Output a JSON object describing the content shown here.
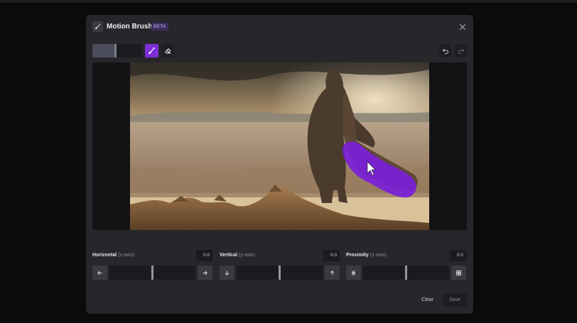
{
  "header": {
    "title": "Motion Brush",
    "badge": "BETA",
    "brand_icon": "brush-icon",
    "close_icon": "close-icon"
  },
  "toolbar": {
    "brush_size_fraction": 0.48,
    "brush_tool": "brush-icon",
    "eraser_tool": "eraser-icon",
    "undo_icon": "undo-icon",
    "redo_icon": "redo-icon"
  },
  "axes": [
    {
      "label": "Horizontal",
      "sub": "(x-axis)",
      "value": "0.0",
      "level": 0.5,
      "left_icon": "arrow-left-icon",
      "right_icon": "arrow-right-icon"
    },
    {
      "label": "Vertical",
      "sub": "(y-axis)",
      "value": "0.0",
      "level": 0.5,
      "left_icon": "arrow-down-icon",
      "right_icon": "arrow-up-icon"
    },
    {
      "label": "Proximity",
      "sub": "(z-axis)",
      "value": "0.0",
      "level": 0.5,
      "left_icon": "shrink-icon",
      "right_icon": "expand-icon"
    }
  ],
  "footer": {
    "clear_label": "Clear",
    "save_label": "Save"
  },
  "colors": {
    "accent": "#7c2fd6",
    "modal_bg": "#26262b",
    "page_bg": "#0b0b0d"
  }
}
